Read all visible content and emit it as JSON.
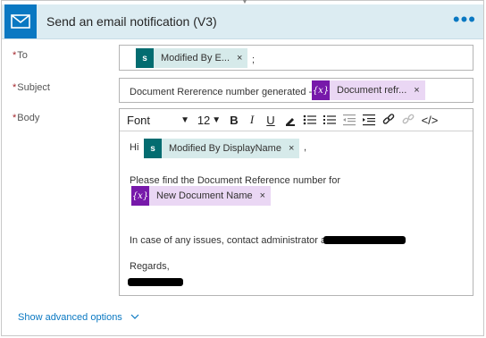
{
  "header": {
    "title": "Send an email notification (V3)",
    "more_label": "•••",
    "icon": "mail-icon",
    "accent_color": "#0a78c2"
  },
  "fields": {
    "to": {
      "label": "To",
      "required_mark": "*",
      "token": {
        "icon": "sharepoint-icon",
        "icon_text": "s",
        "label": "Modified By E...",
        "remove": "×"
      },
      "suffix": ";"
    },
    "subject": {
      "label": "Subject",
      "required_mark": "*",
      "text": "Document Rererence number generated -",
      "token": {
        "icon": "expression-icon",
        "icon_text": "{x}",
        "label": "Document refr...",
        "remove": "×"
      }
    },
    "body": {
      "label": "Body",
      "required_mark": "*",
      "toolbar": {
        "font": "Font",
        "size": "12",
        "bold": "B",
        "italic": "I",
        "underline": "U",
        "code": "</>"
      },
      "greeting": "Hi",
      "token_1": {
        "icon": "sharepoint-icon",
        "icon_text": "s",
        "label": "Modified By DisplayName",
        "remove": "×"
      },
      "greeting_suffix": ",",
      "line_1": "Please find the Document Reference number for",
      "token_2": {
        "icon": "expression-icon",
        "icon_text": "{x}",
        "label": "New Document Name",
        "remove": "×"
      },
      "line_2": "In case of any issues, contact administrator at",
      "line_3": "Regards,"
    }
  },
  "footer": {
    "advanced_label": "Show advanced options"
  }
}
